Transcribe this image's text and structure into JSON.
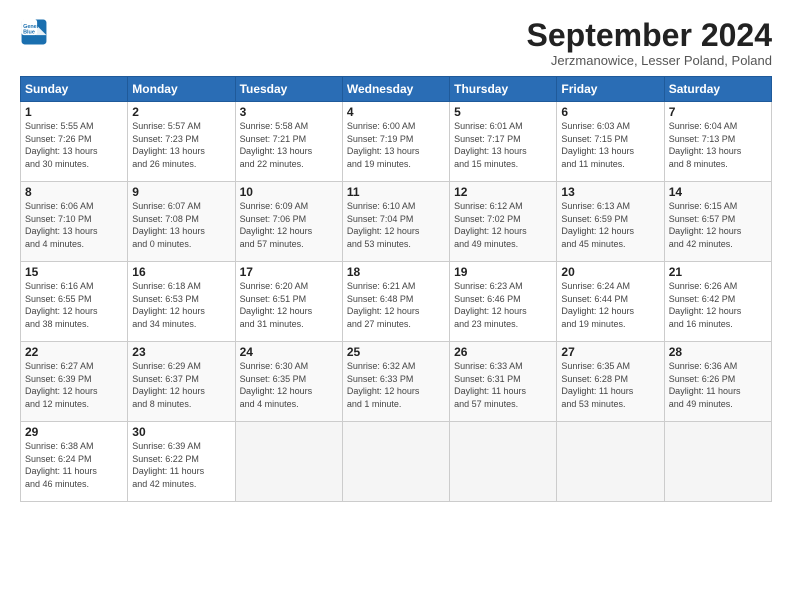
{
  "logo": {
    "line1": "General",
    "line2": "Blue"
  },
  "title": "September 2024",
  "subtitle": "Jerzmanowice, Lesser Poland, Poland",
  "days_of_week": [
    "Sunday",
    "Monday",
    "Tuesday",
    "Wednesday",
    "Thursday",
    "Friday",
    "Saturday"
  ],
  "weeks": [
    [
      {
        "day": "1",
        "info": "Sunrise: 5:55 AM\nSunset: 7:26 PM\nDaylight: 13 hours\nand 30 minutes."
      },
      {
        "day": "2",
        "info": "Sunrise: 5:57 AM\nSunset: 7:23 PM\nDaylight: 13 hours\nand 26 minutes."
      },
      {
        "day": "3",
        "info": "Sunrise: 5:58 AM\nSunset: 7:21 PM\nDaylight: 13 hours\nand 22 minutes."
      },
      {
        "day": "4",
        "info": "Sunrise: 6:00 AM\nSunset: 7:19 PM\nDaylight: 13 hours\nand 19 minutes."
      },
      {
        "day": "5",
        "info": "Sunrise: 6:01 AM\nSunset: 7:17 PM\nDaylight: 13 hours\nand 15 minutes."
      },
      {
        "day": "6",
        "info": "Sunrise: 6:03 AM\nSunset: 7:15 PM\nDaylight: 13 hours\nand 11 minutes."
      },
      {
        "day": "7",
        "info": "Sunrise: 6:04 AM\nSunset: 7:13 PM\nDaylight: 13 hours\nand 8 minutes."
      }
    ],
    [
      {
        "day": "8",
        "info": "Sunrise: 6:06 AM\nSunset: 7:10 PM\nDaylight: 13 hours\nand 4 minutes."
      },
      {
        "day": "9",
        "info": "Sunrise: 6:07 AM\nSunset: 7:08 PM\nDaylight: 13 hours\nand 0 minutes."
      },
      {
        "day": "10",
        "info": "Sunrise: 6:09 AM\nSunset: 7:06 PM\nDaylight: 12 hours\nand 57 minutes."
      },
      {
        "day": "11",
        "info": "Sunrise: 6:10 AM\nSunset: 7:04 PM\nDaylight: 12 hours\nand 53 minutes."
      },
      {
        "day": "12",
        "info": "Sunrise: 6:12 AM\nSunset: 7:02 PM\nDaylight: 12 hours\nand 49 minutes."
      },
      {
        "day": "13",
        "info": "Sunrise: 6:13 AM\nSunset: 6:59 PM\nDaylight: 12 hours\nand 45 minutes."
      },
      {
        "day": "14",
        "info": "Sunrise: 6:15 AM\nSunset: 6:57 PM\nDaylight: 12 hours\nand 42 minutes."
      }
    ],
    [
      {
        "day": "15",
        "info": "Sunrise: 6:16 AM\nSunset: 6:55 PM\nDaylight: 12 hours\nand 38 minutes."
      },
      {
        "day": "16",
        "info": "Sunrise: 6:18 AM\nSunset: 6:53 PM\nDaylight: 12 hours\nand 34 minutes."
      },
      {
        "day": "17",
        "info": "Sunrise: 6:20 AM\nSunset: 6:51 PM\nDaylight: 12 hours\nand 31 minutes."
      },
      {
        "day": "18",
        "info": "Sunrise: 6:21 AM\nSunset: 6:48 PM\nDaylight: 12 hours\nand 27 minutes."
      },
      {
        "day": "19",
        "info": "Sunrise: 6:23 AM\nSunset: 6:46 PM\nDaylight: 12 hours\nand 23 minutes."
      },
      {
        "day": "20",
        "info": "Sunrise: 6:24 AM\nSunset: 6:44 PM\nDaylight: 12 hours\nand 19 minutes."
      },
      {
        "day": "21",
        "info": "Sunrise: 6:26 AM\nSunset: 6:42 PM\nDaylight: 12 hours\nand 16 minutes."
      }
    ],
    [
      {
        "day": "22",
        "info": "Sunrise: 6:27 AM\nSunset: 6:39 PM\nDaylight: 12 hours\nand 12 minutes."
      },
      {
        "day": "23",
        "info": "Sunrise: 6:29 AM\nSunset: 6:37 PM\nDaylight: 12 hours\nand 8 minutes."
      },
      {
        "day": "24",
        "info": "Sunrise: 6:30 AM\nSunset: 6:35 PM\nDaylight: 12 hours\nand 4 minutes."
      },
      {
        "day": "25",
        "info": "Sunrise: 6:32 AM\nSunset: 6:33 PM\nDaylight: 12 hours\nand 1 minute."
      },
      {
        "day": "26",
        "info": "Sunrise: 6:33 AM\nSunset: 6:31 PM\nDaylight: 11 hours\nand 57 minutes."
      },
      {
        "day": "27",
        "info": "Sunrise: 6:35 AM\nSunset: 6:28 PM\nDaylight: 11 hours\nand 53 minutes."
      },
      {
        "day": "28",
        "info": "Sunrise: 6:36 AM\nSunset: 6:26 PM\nDaylight: 11 hours\nand 49 minutes."
      }
    ],
    [
      {
        "day": "29",
        "info": "Sunrise: 6:38 AM\nSunset: 6:24 PM\nDaylight: 11 hours\nand 46 minutes."
      },
      {
        "day": "30",
        "info": "Sunrise: 6:39 AM\nSunset: 6:22 PM\nDaylight: 11 hours\nand 42 minutes."
      },
      {
        "day": "",
        "info": ""
      },
      {
        "day": "",
        "info": ""
      },
      {
        "day": "",
        "info": ""
      },
      {
        "day": "",
        "info": ""
      },
      {
        "day": "",
        "info": ""
      }
    ]
  ]
}
